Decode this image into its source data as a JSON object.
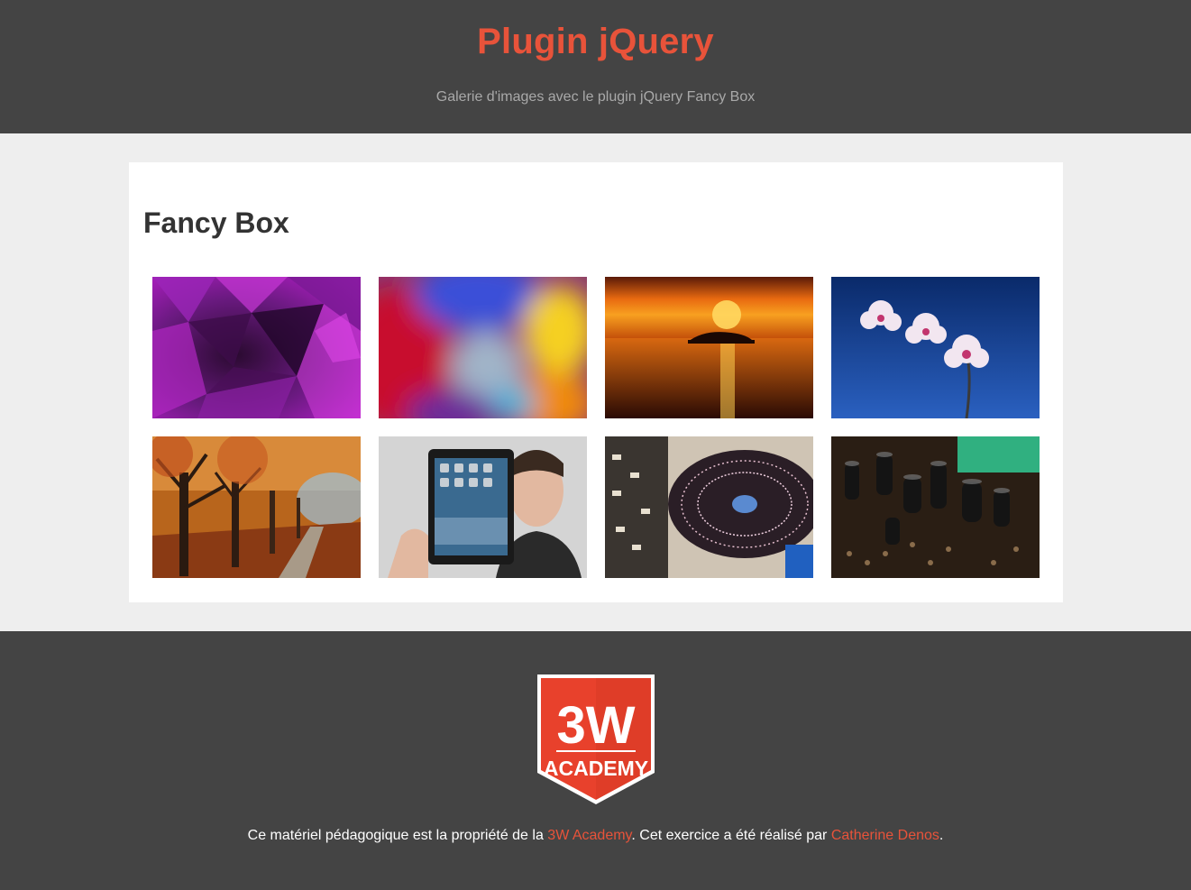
{
  "header": {
    "title": "Plugin jQuery",
    "subtitle": "Galerie d'images avec le plugin jQuery Fancy Box"
  },
  "section": {
    "title": "Fancy Box"
  },
  "gallery": {
    "images": [
      {
        "subject": "purple abstract polygons"
      },
      {
        "subject": "blurred colorful abstract"
      },
      {
        "subject": "sunset over lake with island"
      },
      {
        "subject": "white orchids on blue sky"
      },
      {
        "subject": "autumn tree-lined path"
      },
      {
        "subject": "man holding tablet"
      },
      {
        "subject": "DJ turntable"
      },
      {
        "subject": "circuit board capacitors"
      }
    ]
  },
  "footer": {
    "logo": {
      "line1": "3W",
      "line2": "ACADEMY"
    },
    "credits_prefix": "Ce matériel pédagogique est la propriété de la ",
    "academy_link": "3W Academy",
    "credits_middle": ". Cet exercice a été réalisé par ",
    "author_link": "Catherine Denos",
    "credits_suffix": "."
  },
  "colors": {
    "accent": "#e8533a",
    "header_bg": "#444444",
    "page_bg": "#eeeeee"
  }
}
